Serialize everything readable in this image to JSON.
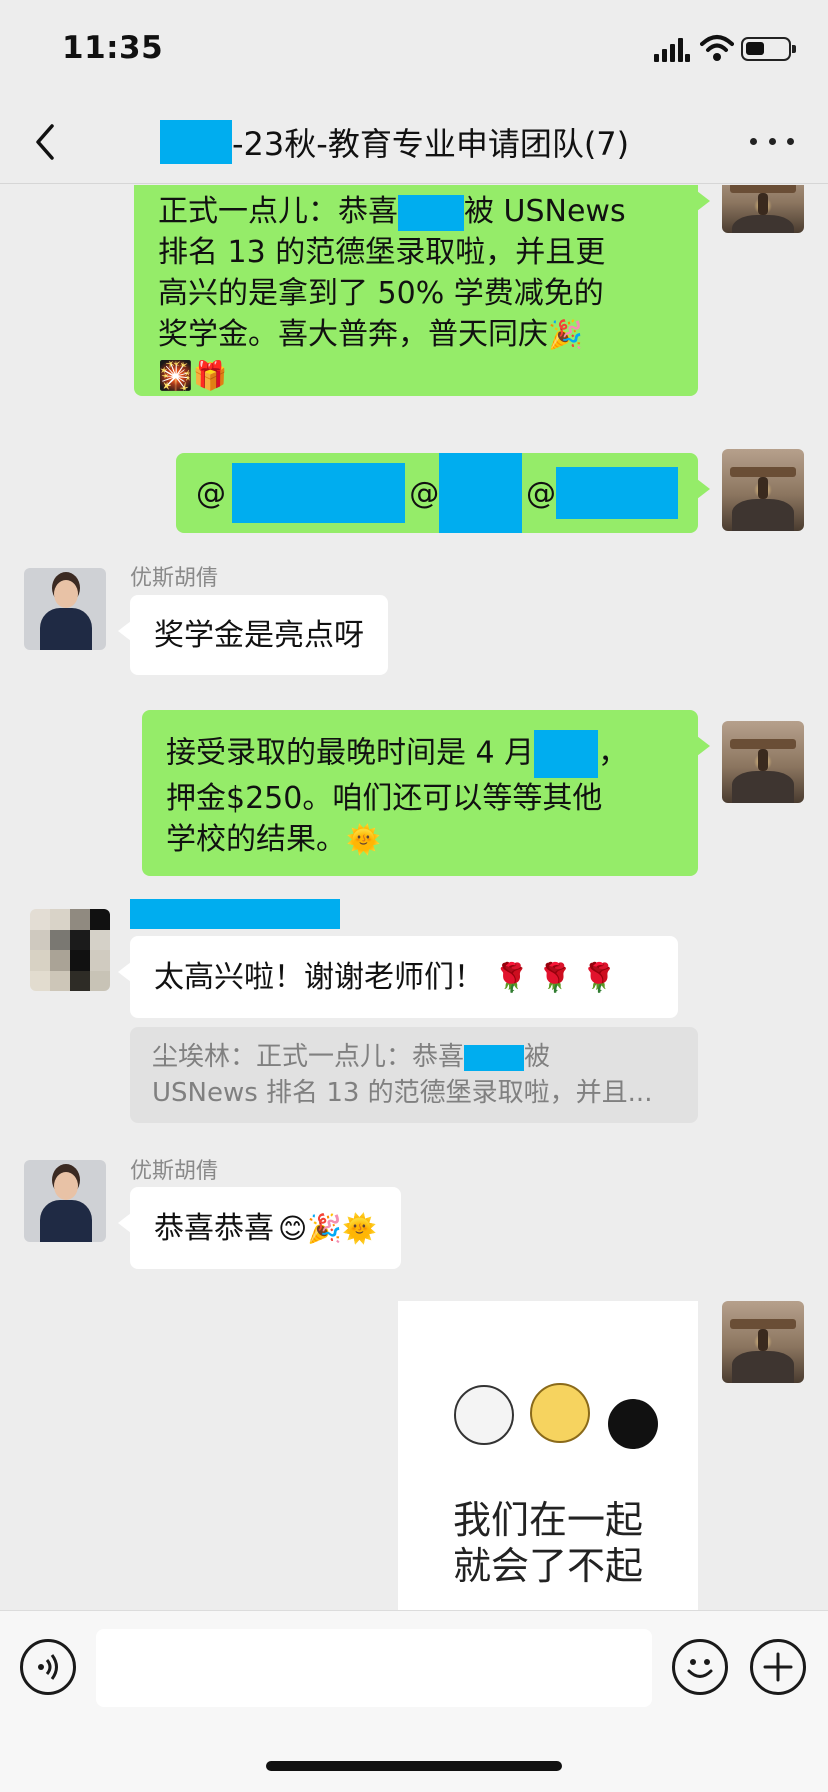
{
  "status_bar": {
    "time": "11:35",
    "icons": [
      "cellular-signal-icon",
      "wifi-icon",
      "battery-icon"
    ],
    "battery_level": 0.45
  },
  "nav": {
    "title": "-23秋-教育专业申请团队(7)",
    "back_icon": "chevron-left-icon",
    "more_icon": "ellipsis-icon"
  },
  "messages": {
    "m1": {
      "line1": "正式一点儿：恭喜",
      "line1_after": "被 USNews",
      "line2": "排名 13 的范德堡录取啦，并且更",
      "line3": "高兴的是拿到了 50% 学费减免的",
      "line4": "奖学金。喜大普奔，普天同庆",
      "emoji_end": "🎉",
      "line5": "🎇🎁"
    },
    "m2": {
      "at1": "@",
      "at2": "@",
      "at3": "@"
    },
    "m3": {
      "sender": "优斯胡倩",
      "text": "奖学金是亮点呀"
    },
    "m4": {
      "line1_before": "接受录取的最晚时间是 4 月",
      "line1_after": "，",
      "line2": "押金$250。咱们还可以等等其他",
      "line3": "学校的结果。",
      "emoji": "🌞"
    },
    "m5": {
      "text": "太高兴啦！谢谢老师们！",
      "emoji": "🌹 🌹 🌹"
    },
    "quote": {
      "line1_before": "尘埃林：正式一点儿：恭喜",
      "line1_after": "被",
      "line2": "USNews 排名 13 的范德堡录取啦，并且..."
    },
    "m6": {
      "sender": "优斯胡倩",
      "text": "恭喜恭喜",
      "emoji": "😊🎉🌞"
    },
    "sticker": {
      "line1": "我们在一起",
      "line2": "就会了不起"
    }
  },
  "input_bar": {
    "voice_icon": "voice-icon",
    "emoji_icon": "emoji-icon",
    "plus_icon": "plus-icon",
    "placeholder": ""
  },
  "colors": {
    "self_bubble": "#95ec69",
    "other_bubble": "#ffffff",
    "background": "#ededed",
    "redaction": "#00adef"
  }
}
